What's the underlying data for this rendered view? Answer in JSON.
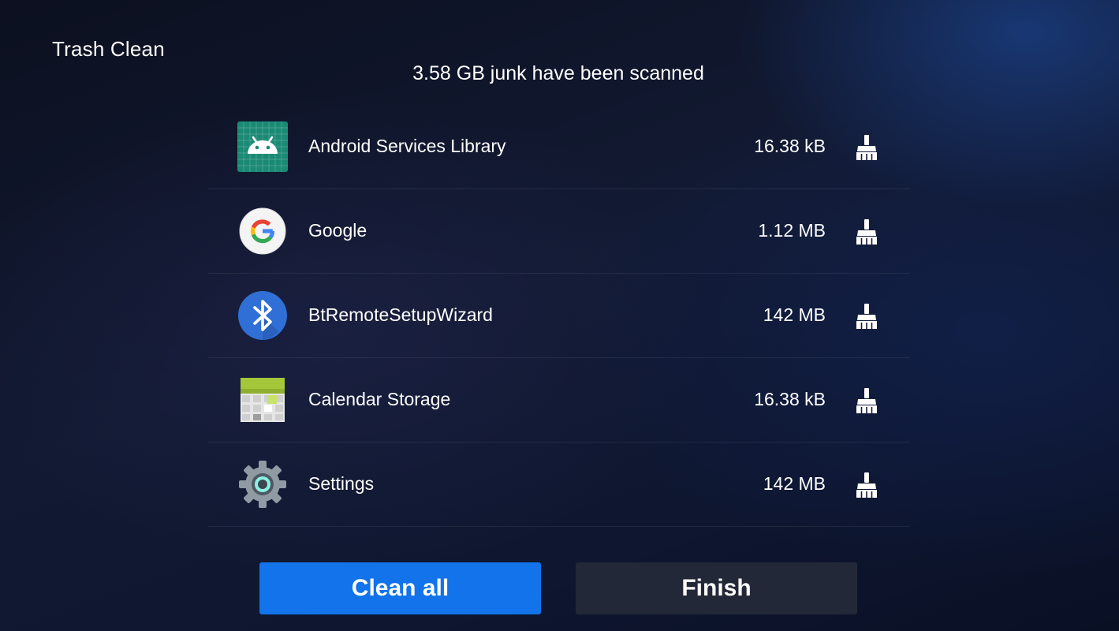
{
  "header": {
    "title": "Trash Clean",
    "summary": "3.58 GB junk have been scanned"
  },
  "items": [
    {
      "name": "Android Services Library",
      "size": "16.38 kB",
      "icon": "android-icon"
    },
    {
      "name": "Google",
      "size": "1.12 MB",
      "icon": "google-icon"
    },
    {
      "name": "BtRemoteSetupWizard",
      "size": "142 MB",
      "icon": "bluetooth-icon"
    },
    {
      "name": "Calendar Storage",
      "size": "16.38 kB",
      "icon": "calendar-storage-icon"
    },
    {
      "name": "Settings",
      "size": "142 MB",
      "icon": "settings-gear-icon"
    }
  ],
  "actions": {
    "clean_all": "Clean all",
    "finish": "Finish"
  },
  "colors": {
    "primary_button": "#1273ea",
    "secondary_button": "#232838",
    "android_icon": "#1b8a74",
    "bluetooth_icon": "#2f6fd6"
  }
}
